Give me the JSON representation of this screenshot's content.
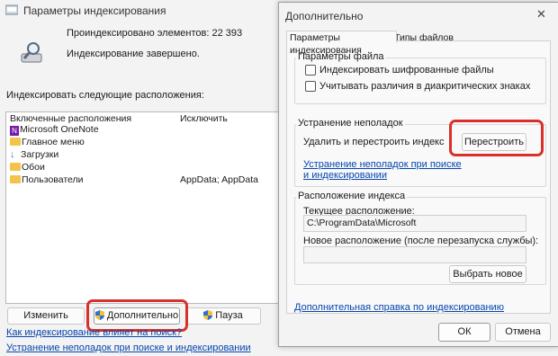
{
  "back_window": {
    "title": "Параметры индексирования",
    "indexed_count": "Проиндексировано элементов: 22 393",
    "status": "Индексирование завершено.",
    "locations_label": "Индексировать следующие расположения:",
    "columns": {
      "included": "Включенные расположения",
      "exclude": "Исключить"
    },
    "locations": [
      {
        "icon": "onenote-icon",
        "name": "Microsoft OneNote",
        "exclude": ""
      },
      {
        "icon": "folder-icon",
        "name": "Главное меню",
        "exclude": ""
      },
      {
        "icon": "download-icon",
        "name": "Загрузки",
        "exclude": ""
      },
      {
        "icon": "folder-icon",
        "name": "Обои",
        "exclude": ""
      },
      {
        "icon": "folder-icon",
        "name": "Пользователи",
        "exclude": "AppData; AppData"
      }
    ],
    "buttons": {
      "modify": "Изменить",
      "advanced": "Дополнительно",
      "pause": "Пауза"
    },
    "links": {
      "how_affects": "Как индексирование влияет на поиск?",
      "troubleshoot": "Устранение неполадок при поиске и индексировании"
    }
  },
  "dialog": {
    "title": "Дополнительно",
    "tabs": [
      "Параметры индексирования",
      "Типы файлов"
    ],
    "file_settings": {
      "label": "Параметры файла",
      "encrypt": "Индексировать шифрованные файлы",
      "diacritics": "Учитывать различия в диакритических знаках"
    },
    "troubleshooting": {
      "label": "Устранение неполадок",
      "rebuild_text": "Удалить и перестроить индекс",
      "rebuild_button": "Перестроить",
      "link": "Устранение неполадок при поиске и индексировании"
    },
    "index_location": {
      "label": "Расположение индекса",
      "current_label": "Текущее расположение:",
      "current_value": "C:\\ProgramData\\Microsoft",
      "new_label": "Новое расположение (после перезапуска службы):",
      "new_value": "",
      "select_button": "Выбрать новое"
    },
    "help_link": "Дополнительная справка по индексированию",
    "ok": "ОК",
    "cancel": "Отмена",
    "close_glyph": "✕"
  },
  "colors": {
    "highlight": "#d9302a",
    "link": "#0645ad",
    "folder": "#f3c44b",
    "onenote": "#7719aa"
  }
}
